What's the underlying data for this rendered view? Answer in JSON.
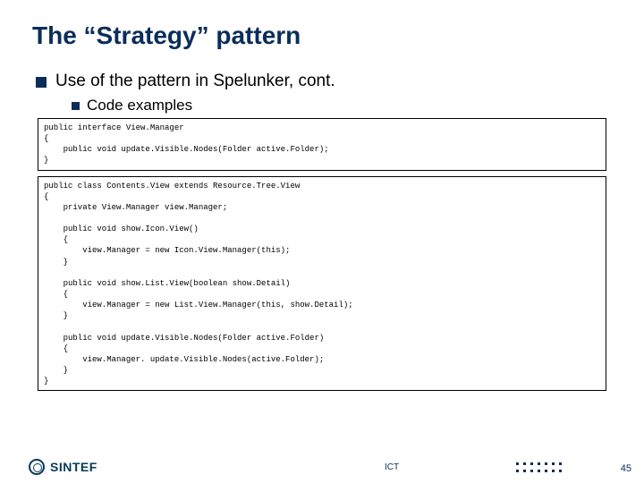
{
  "title": "The “Strategy” pattern",
  "bullet1": "Use of the pattern in Spelunker, cont.",
  "bullet2": "Code examples",
  "code1": "public interface View.Manager\n{\n    public void update.Visible.Nodes(Folder active.Folder);\n}",
  "code2": "public class Contents.View extends Resource.Tree.View\n{\n    private View.Manager view.Manager;\n\n    public void show.Icon.View()\n    {\n        view.Manager = new Icon.View.Manager(this);\n    }\n\n    public void show.List.View(boolean show.Detail)\n    {\n        view.Manager = new List.View.Manager(this, show.Detail);\n    }\n\n    public void update.Visible.Nodes(Folder active.Folder)\n    {\n        view.Manager. update.Visible.Nodes(active.Folder);\n    }\n}",
  "footer": {
    "logo": "SINTEF",
    "label": "ICT",
    "page": "45"
  }
}
